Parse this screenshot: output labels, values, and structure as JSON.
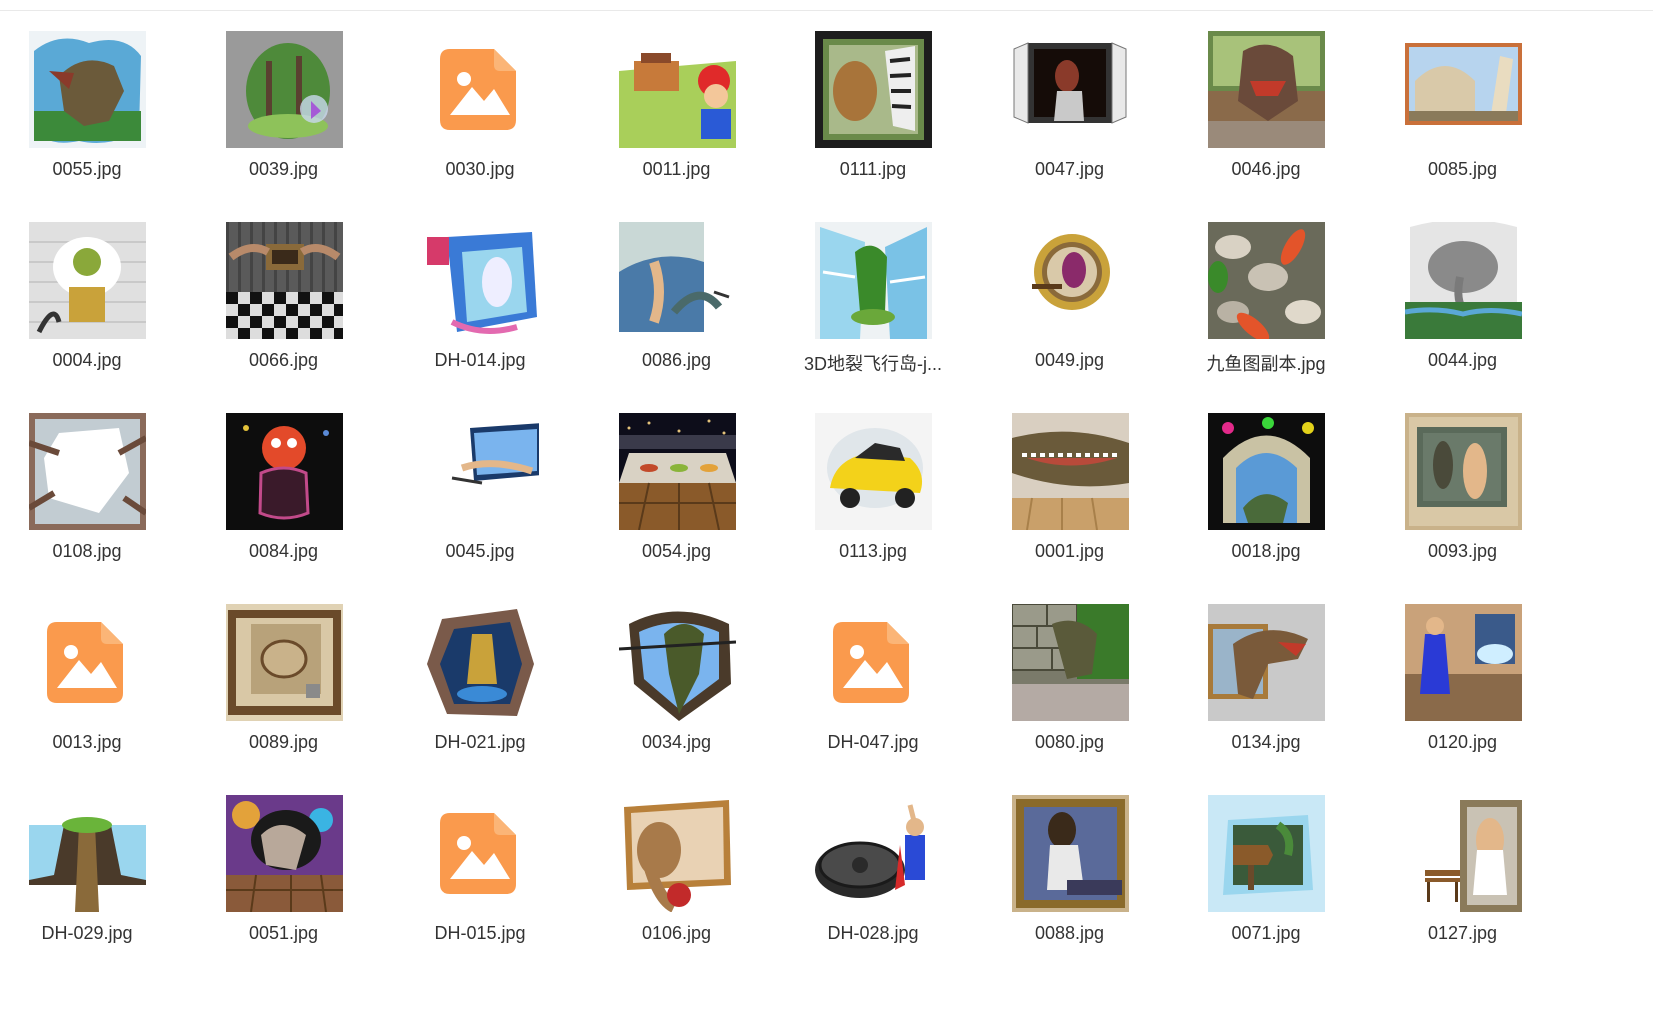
{
  "file_grid": {
    "items": [
      {
        "name": "0055.jpg",
        "icon": "dinosaur-wall-thumbnail-icon",
        "kind": "dino"
      },
      {
        "name": "0039.jpg",
        "icon": "forest-wall-thumbnail-icon",
        "kind": "forest"
      },
      {
        "name": "0030.jpg",
        "icon": "image-file-icon",
        "kind": "generic"
      },
      {
        "name": "0011.jpg",
        "icon": "mario-wall-thumbnail-icon",
        "kind": "mario"
      },
      {
        "name": "0111.jpg",
        "icon": "lion-zebra-thumbnail-icon",
        "kind": "frame-green"
      },
      {
        "name": "0047.jpg",
        "icon": "window-woman-thumbnail-icon",
        "kind": "window"
      },
      {
        "name": "0046.jpg",
        "icon": "trex-kitchen-thumbnail-icon",
        "kind": "dino-brown"
      },
      {
        "name": "0085.jpg",
        "icon": "pisa-tower-thumbnail-icon",
        "kind": "pisa"
      },
      {
        "name": "0004.jpg",
        "icon": "shrek-throne-thumbnail-icon",
        "kind": "brick-white"
      },
      {
        "name": "0066.jpg",
        "icon": "hands-frame-thumbnail-icon",
        "kind": "checker"
      },
      {
        "name": "DH-014.jpg",
        "icon": "waterfall-wall-thumbnail-icon",
        "kind": "splash-blue"
      },
      {
        "name": "0086.jpg",
        "icon": "mermaid-thumbnail-icon",
        "kind": "ocean"
      },
      {
        "name": "3D地裂飞行岛-j...",
        "icon": "flying-island-thumbnail-icon",
        "kind": "waterfall"
      },
      {
        "name": "0049.jpg",
        "icon": "porthole-woman-thumbnail-icon",
        "kind": "porthole"
      },
      {
        "name": "九鱼图副本.jpg",
        "icon": "koi-pebbles-thumbnail-icon",
        "kind": "koi"
      },
      {
        "name": "0044.jpg",
        "icon": "elephant-wall-thumbnail-icon",
        "kind": "elephant"
      },
      {
        "name": "0108.jpg",
        "icon": "broken-mirror-hands-thumbnail-icon",
        "kind": "shatter"
      },
      {
        "name": "0084.jpg",
        "icon": "clown-jar-thumbnail-icon",
        "kind": "clown"
      },
      {
        "name": "0045.jpg",
        "icon": "tv-beach-thumbnail-icon",
        "kind": "tv"
      },
      {
        "name": "0054.jpg",
        "icon": "dinner-table-city-thumbnail-icon",
        "kind": "dinner"
      },
      {
        "name": "0113.jpg",
        "icon": "yellow-car-thumbnail-icon",
        "kind": "car"
      },
      {
        "name": "0001.jpg",
        "icon": "crocodile-wall-thumbnail-icon",
        "kind": "croc"
      },
      {
        "name": "0018.jpg",
        "icon": "dinosaur-arch-thumbnail-icon",
        "kind": "arch"
      },
      {
        "name": "0093.jpg",
        "icon": "frame-woman-thumbnail-icon",
        "kind": "frame-tan"
      },
      {
        "name": "0013.jpg",
        "icon": "image-file-icon",
        "kind": "generic"
      },
      {
        "name": "0089.jpg",
        "icon": "frame-creature-thumbnail-icon",
        "kind": "frame-sepia"
      },
      {
        "name": "DH-021.jpg",
        "icon": "hole-knight-thumbnail-icon",
        "kind": "hole"
      },
      {
        "name": "0034.jpg",
        "icon": "dino-hole-thumbnail-icon",
        "kind": "dino-hole"
      },
      {
        "name": "DH-047.jpg",
        "icon": "image-file-icon",
        "kind": "generic"
      },
      {
        "name": "0080.jpg",
        "icon": "dino-stone-wall-thumbnail-icon",
        "kind": "stone"
      },
      {
        "name": "0134.jpg",
        "icon": "trex-frame-thumbnail-icon",
        "kind": "trex-frame"
      },
      {
        "name": "0120.jpg",
        "icon": "street-fighter-thumbnail-icon",
        "kind": "street"
      },
      {
        "name": "DH-029.jpg",
        "icon": "bridge-chasm-thumbnail-icon",
        "kind": "bridge"
      },
      {
        "name": "0051.jpg",
        "icon": "hole-floor-thumbnail-icon",
        "kind": "hole-floor"
      },
      {
        "name": "DH-015.jpg",
        "icon": "image-file-icon",
        "kind": "generic"
      },
      {
        "name": "0106.jpg",
        "icon": "puma-frame-thumbnail-icon",
        "kind": "puma"
      },
      {
        "name": "DH-028.jpg",
        "icon": "superman-manhole-thumbnail-icon",
        "kind": "superman"
      },
      {
        "name": "0088.jpg",
        "icon": "woman-painting-thumbnail-icon",
        "kind": "woman-frame"
      },
      {
        "name": "0071.jpg",
        "icon": "ice-sign-thumbnail-icon",
        "kind": "ice"
      },
      {
        "name": "0127.jpg",
        "icon": "violinist-frame-thumbnail-icon",
        "kind": "violin"
      }
    ]
  },
  "colors": {
    "generic_icon_fill": "#fa9a4d",
    "label_text": "#333333",
    "background": "#ffffff"
  }
}
